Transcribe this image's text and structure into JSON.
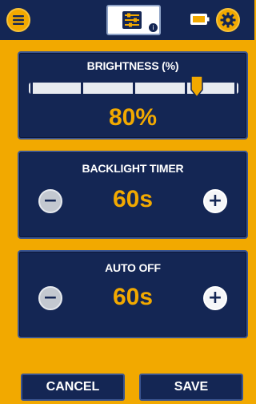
{
  "brightness": {
    "title": "BRIGHTNESS (%)",
    "value_text": "80%",
    "level": 0.8
  },
  "backlight_timer": {
    "title": "BACKLIGHT TIMER",
    "value_text": "60s"
  },
  "auto_off": {
    "title": "AUTO OFF",
    "value_text": "60s"
  },
  "buttons": {
    "cancel": "CANCEL",
    "save": "SAVE"
  },
  "header": {
    "info_glyph": "i"
  },
  "colors": {
    "background": "#f2a900",
    "panel": "#142654",
    "accent": "#f2a900",
    "text": "#ffffff"
  },
  "icons": {
    "menu": "menu-icon",
    "logo": "equalizer-logo-icon",
    "info": "info-icon",
    "battery": "battery-icon",
    "settings": "gear-icon",
    "decrease": "minus-icon",
    "increase": "plus-icon",
    "slider_handle": "slider-thumb-icon"
  }
}
